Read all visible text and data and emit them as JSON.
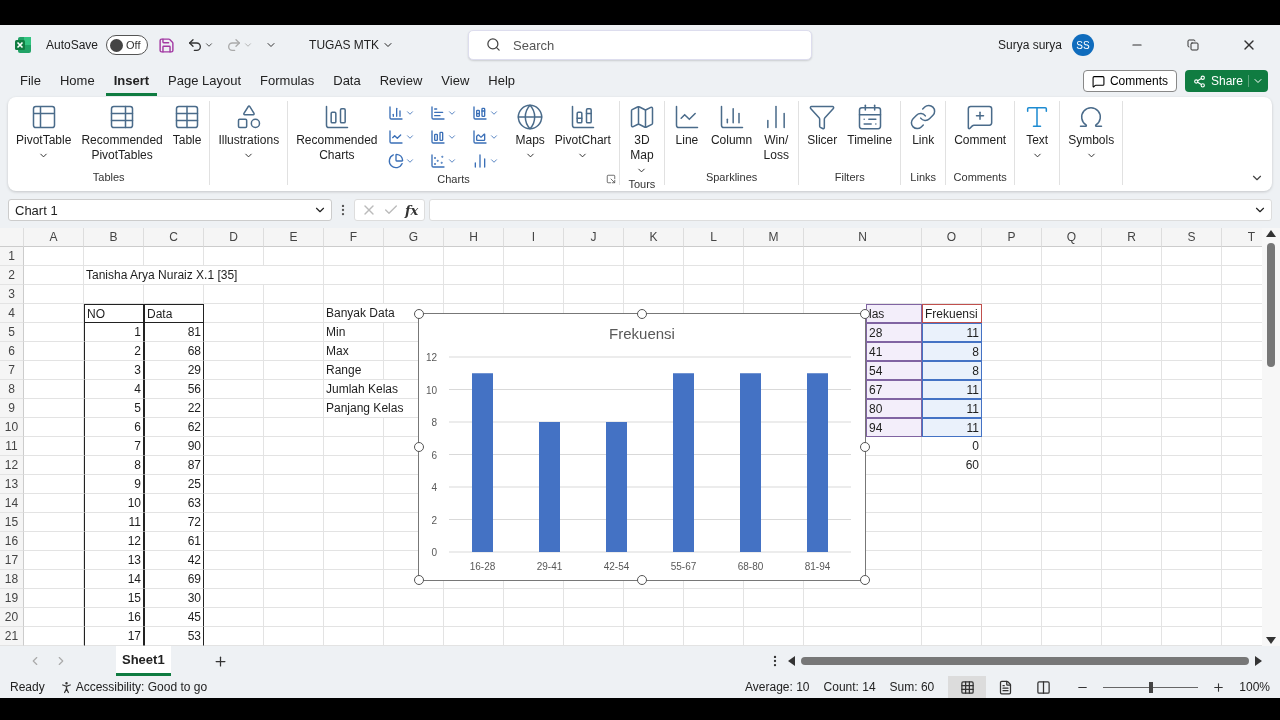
{
  "title_bar": {
    "autosave_label": "AutoSave",
    "autosave": {
      "on": false,
      "label": "Off"
    },
    "file_name": "TUGAS MTK",
    "search": {
      "placeholder": "Search"
    },
    "user_name": "Surya surya",
    "user_initials": "SS"
  },
  "menu_tabs": [
    {
      "label": "File",
      "selected": false
    },
    {
      "label": "Home",
      "selected": false
    },
    {
      "label": "Insert",
      "selected": true
    },
    {
      "label": "Page Layout",
      "selected": false
    },
    {
      "label": "Formulas",
      "selected": false
    },
    {
      "label": "Data",
      "selected": false
    },
    {
      "label": "Review",
      "selected": false
    },
    {
      "label": "View",
      "selected": false
    },
    {
      "label": "Help",
      "selected": false
    }
  ],
  "header_buttons": {
    "comments": "Comments",
    "share": "Share"
  },
  "ribbon_groups": [
    {
      "name": "Tables",
      "items": [
        {
          "label": "PivotTable",
          "dropdown": true
        },
        {
          "label": "Recommended\nPivotTables",
          "dropdown": false
        },
        {
          "label": "Table",
          "dropdown": false
        }
      ]
    },
    {
      "items": [
        {
          "label": "Illustrations",
          "dropdown": true
        }
      ]
    },
    {
      "name": "Charts",
      "gallery": true,
      "launcher": true,
      "items": [
        {
          "label": "Recommended\nCharts",
          "dropdown": false
        },
        {
          "label": "Maps",
          "dropdown": true
        },
        {
          "label": "PivotChart",
          "dropdown": true
        }
      ]
    },
    {
      "name": "Tours",
      "items": [
        {
          "label": "3D\nMap",
          "dropdown": true
        }
      ]
    },
    {
      "name": "Sparklines",
      "items": [
        {
          "label": "Line",
          "dropdown": false
        },
        {
          "label": "Column",
          "dropdown": false
        },
        {
          "label": "Win/\nLoss",
          "dropdown": false
        }
      ]
    },
    {
      "name": "Filters",
      "items": [
        {
          "label": "Slicer",
          "dropdown": false
        },
        {
          "label": "Timeline",
          "dropdown": false
        }
      ]
    },
    {
      "name": "Links",
      "items": [
        {
          "label": "Link",
          "dropdown": false
        }
      ]
    },
    {
      "name": "Comments",
      "items": [
        {
          "label": "Comment",
          "dropdown": false
        }
      ]
    },
    {
      "items": [
        {
          "label": "Text",
          "dropdown": true
        }
      ]
    },
    {
      "items": [
        {
          "label": "Symbols",
          "dropdown": true
        }
      ]
    }
  ],
  "formula_bar": {
    "name_box": "Chart 1",
    "function_symbol": "fx"
  },
  "columns": [
    "A",
    "B",
    "C",
    "D",
    "E",
    "F",
    "G",
    "H",
    "I",
    "J",
    "K",
    "L",
    "M",
    "N",
    "O",
    "P",
    "Q",
    "R",
    "S",
    "T"
  ],
  "rows": [
    {
      "number": "1",
      "cells": {}
    },
    {
      "number": "2",
      "cells": {
        "B": {
          "text": "Tanisha Arya Nuraiz X.1 [35]"
        }
      }
    },
    {
      "number": "3",
      "cells": {}
    },
    {
      "number": "4",
      "cells": {
        "B": {
          "text": "NO",
          "outlined": true
        },
        "C": {
          "text": "Data",
          "outlined": true
        },
        "F": {
          "text": "Banyak Data"
        },
        "N": {
          "text": "las",
          "category_range": true,
          "covered_left": true
        },
        "O": {
          "text": "Frekuensi",
          "name_range": true
        }
      }
    },
    {
      "number": "5",
      "cells": {
        "B": {
          "text": "1",
          "numeric": true,
          "ruled": true
        },
        "C": {
          "text": "81",
          "numeric": true,
          "ruled": true
        },
        "F": {
          "text": "Min"
        },
        "N": {
          "text": "28",
          "category_range": true,
          "covered_left": true
        },
        "O": {
          "text": "11",
          "numeric": true,
          "value_range": true
        }
      }
    },
    {
      "number": "6",
      "cells": {
        "B": {
          "text": "2",
          "numeric": true,
          "ruled": true
        },
        "C": {
          "text": "68",
          "numeric": true,
          "ruled": true
        },
        "F": {
          "text": "Max"
        },
        "N": {
          "text": "41",
          "category_range": true,
          "covered_left": true
        },
        "O": {
          "text": "8",
          "numeric": true,
          "value_range": true
        }
      }
    },
    {
      "number": "7",
      "cells": {
        "B": {
          "text": "3",
          "numeric": true,
          "ruled": true
        },
        "C": {
          "text": "29",
          "numeric": true,
          "ruled": true
        },
        "F": {
          "text": "Range"
        },
        "N": {
          "text": "54",
          "category_range": true,
          "covered_left": true
        },
        "O": {
          "text": "8",
          "numeric": true,
          "value_range": true
        }
      }
    },
    {
      "number": "8",
      "cells": {
        "B": {
          "text": "4",
          "numeric": true,
          "ruled": true
        },
        "C": {
          "text": "56",
          "numeric": true,
          "ruled": true
        },
        "F": {
          "text": "Jumlah Kelas"
        },
        "N": {
          "text": "67",
          "category_range": true,
          "covered_left": true
        },
        "O": {
          "text": "11",
          "numeric": true,
          "value_range": true
        }
      }
    },
    {
      "number": "9",
      "cells": {
        "B": {
          "text": "5",
          "numeric": true,
          "ruled": true
        },
        "C": {
          "text": "22",
          "numeric": true,
          "ruled": true
        },
        "F": {
          "text": "Panjang Kelas"
        },
        "N": {
          "text": "80",
          "category_range": true,
          "covered_left": true
        },
        "O": {
          "text": "11",
          "numeric": true,
          "value_range": true
        }
      }
    },
    {
      "number": "10",
      "cells": {
        "B": {
          "text": "6",
          "numeric": true,
          "ruled": true
        },
        "C": {
          "text": "62",
          "numeric": true,
          "ruled": true
        },
        "N": {
          "text": "94",
          "category_range": true,
          "covered_left": true
        },
        "O": {
          "text": "11",
          "numeric": true,
          "value_range": true
        }
      }
    },
    {
      "number": "11",
      "cells": {
        "B": {
          "text": "7",
          "numeric": true,
          "ruled": true
        },
        "C": {
          "text": "90",
          "numeric": true,
          "ruled": true
        },
        "O": {
          "text": "0",
          "numeric": true
        }
      }
    },
    {
      "number": "12",
      "cells": {
        "B": {
          "text": "8",
          "numeric": true,
          "ruled": true
        },
        "C": {
          "text": "87",
          "numeric": true,
          "ruled": true
        },
        "O": {
          "text": "60",
          "numeric": true
        }
      }
    },
    {
      "number": "13",
      "cells": {
        "B": {
          "text": "9",
          "numeric": true,
          "ruled": true
        },
        "C": {
          "text": "25",
          "numeric": true,
          "ruled": true
        }
      }
    },
    {
      "number": "14",
      "cells": {
        "B": {
          "text": "10",
          "numeric": true,
          "ruled": true
        },
        "C": {
          "text": "63",
          "numeric": true,
          "ruled": true
        }
      }
    },
    {
      "number": "15",
      "cells": {
        "B": {
          "text": "11",
          "numeric": true,
          "ruled": true
        },
        "C": {
          "text": "72",
          "numeric": true,
          "ruled": true
        }
      }
    },
    {
      "number": "16",
      "cells": {
        "B": {
          "text": "12",
          "numeric": true,
          "ruled": true
        },
        "C": {
          "text": "61",
          "numeric": true,
          "ruled": true
        }
      }
    },
    {
      "number": "17",
      "cells": {
        "B": {
          "text": "13",
          "numeric": true,
          "ruled": true
        },
        "C": {
          "text": "42",
          "numeric": true,
          "ruled": true
        }
      }
    },
    {
      "number": "18",
      "cells": {
        "B": {
          "text": "14",
          "numeric": true,
          "ruled": true
        },
        "C": {
          "text": "69",
          "numeric": true,
          "ruled": true
        }
      }
    },
    {
      "number": "19",
      "cells": {
        "B": {
          "text": "15",
          "numeric": true,
          "ruled": true
        },
        "C": {
          "text": "30",
          "numeric": true,
          "ruled": true
        }
      }
    },
    {
      "number": "20",
      "cells": {
        "B": {
          "text": "16",
          "numeric": true,
          "ruled": true
        },
        "C": {
          "text": "45",
          "numeric": true,
          "ruled": true
        }
      }
    },
    {
      "number": "21",
      "cells": {
        "B": {
          "text": "17",
          "numeric": true,
          "ruled": true
        },
        "C": {
          "text": "53",
          "numeric": true,
          "ruled": true
        }
      }
    }
  ],
  "chart": {
    "selected": true,
    "chart_data": {
      "type": "bar",
      "title": "Frekuensi",
      "categories": [
        "16-28",
        "29-41",
        "42-54",
        "55-67",
        "68-80",
        "81-94"
      ],
      "series": [
        {
          "color": "#4472c4",
          "values": [
            11,
            8,
            8,
            11,
            11,
            11
          ]
        }
      ],
      "ylim": [
        0,
        12
      ],
      "yticks": [
        0,
        2,
        4,
        6,
        8,
        10,
        12
      ],
      "grid": true
    }
  },
  "sheet_tabs": [
    {
      "label": "Sheet1",
      "selected": true
    }
  ],
  "status_bar": {
    "mode": "Ready",
    "accessibility": "Accessibility: Good to go",
    "stats": [
      "Average: 10",
      "Count: 14",
      "Sum: 60"
    ],
    "views": [
      {
        "kind": "normal",
        "selected": true
      },
      {
        "kind": "page-layout",
        "selected": false
      },
      {
        "kind": "page-break",
        "selected": false
      }
    ],
    "zoom": {
      "level": 0.5,
      "label": "100%"
    }
  }
}
